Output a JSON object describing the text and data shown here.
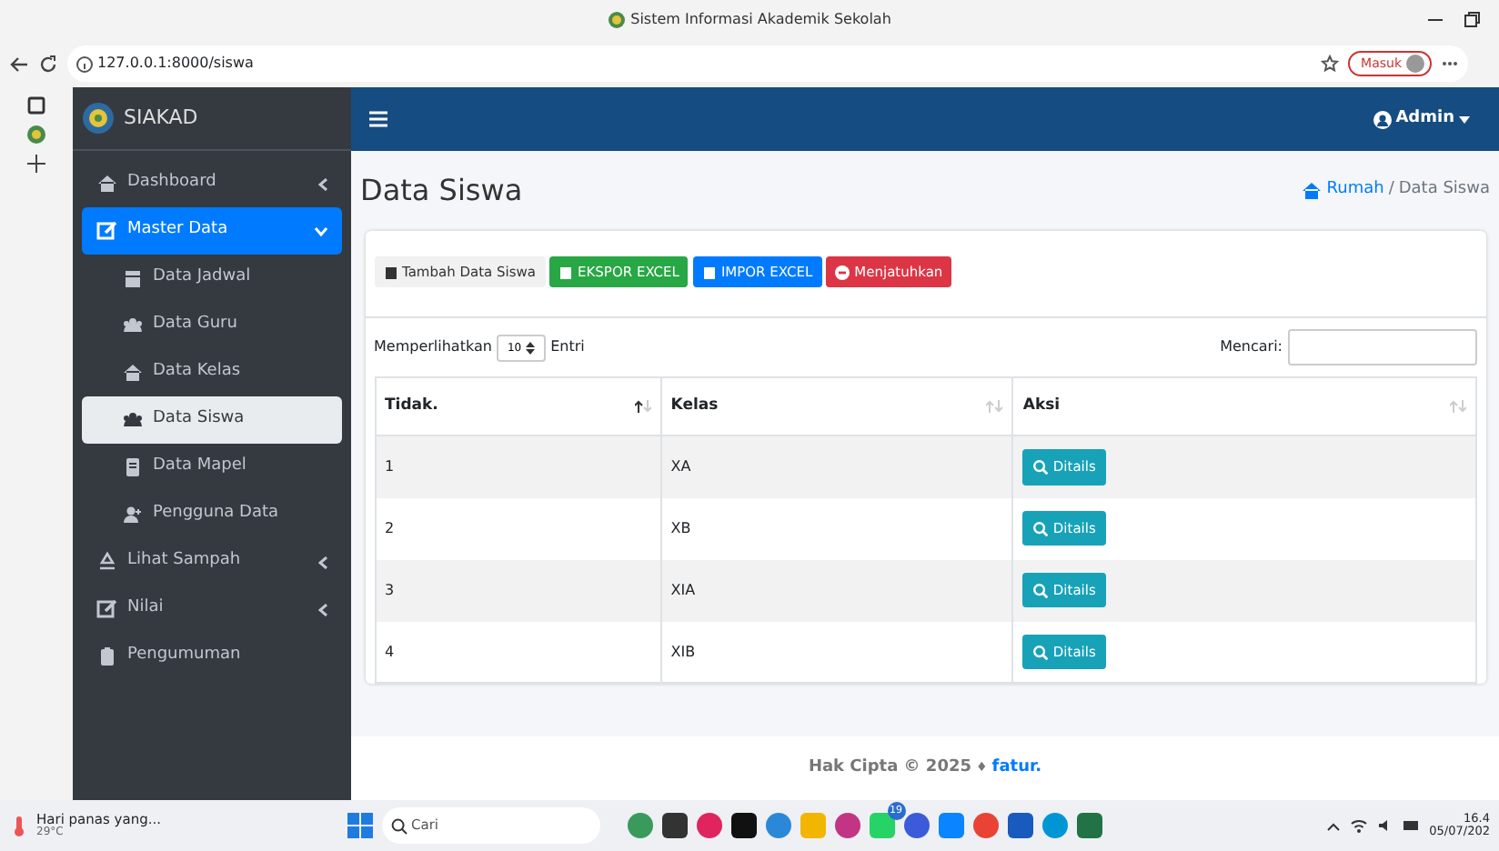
{
  "browser": {
    "title": "Sistem Informasi Akademik Sekolah",
    "url": "127.0.0.1:8000/siswa",
    "profile_button": "Masuk"
  },
  "app": {
    "brand": "SIAKAD",
    "user": "Admin"
  },
  "sidebar": {
    "items": [
      {
        "label": "Dashboard",
        "expanded": false,
        "selected": false
      },
      {
        "label": "Master Data",
        "expanded": true,
        "selected": true,
        "children": [
          {
            "label": "Data Jadwal",
            "selected": false
          },
          {
            "label": "Data Guru",
            "selected": false
          },
          {
            "label": "Data Kelas",
            "selected": false
          },
          {
            "label": "Data Siswa",
            "selected": true
          },
          {
            "label": "Data Mapel",
            "selected": false
          },
          {
            "label": "Pengguna Data",
            "selected": false
          }
        ]
      },
      {
        "label": "Lihat Sampah",
        "expanded": false,
        "selected": false
      },
      {
        "label": "Nilai",
        "expanded": false,
        "selected": false
      },
      {
        "label": "Pengumuman",
        "selected": false
      }
    ]
  },
  "page": {
    "title": "Data Siswa",
    "breadcrumb": {
      "home": "Rumah",
      "separator": "/",
      "current": "Data Siswa"
    }
  },
  "toolbar": [
    {
      "label": "Tambah Data Siswa",
      "kind": "light"
    },
    {
      "label": "EKSPOR EXCEL",
      "kind": "success"
    },
    {
      "label": "IMPOR EXCEL",
      "kind": "primary"
    },
    {
      "label": "Menjatuhkan",
      "kind": "danger"
    }
  ],
  "length": {
    "label": "Memperlihatkan",
    "value": "10",
    "suffix": "Entri"
  },
  "search": {
    "label": "Mencari:"
  },
  "table": {
    "columns": [
      {
        "label": "Tidak.",
        "sorted": true
      },
      {
        "label": "Kelas",
        "sorted": false
      },
      {
        "label": "Aksi",
        "sorted": false
      }
    ],
    "rows": [
      {
        "no": "1",
        "kelas": "XA",
        "action": "Ditails"
      },
      {
        "no": "2",
        "kelas": "XB",
        "action": "Ditails"
      },
      {
        "no": "3",
        "kelas": "XIA",
        "action": "Ditails"
      },
      {
        "no": "4",
        "kelas": "XIB",
        "action": "Ditails"
      }
    ]
  },
  "footer": {
    "text": "Hak Cipta © 2025",
    "separator": "♦",
    "author": "fatur."
  },
  "taskbar": {
    "weather": "Hari panas yang...",
    "temperature": "29°C",
    "search_placeholder": "Cari",
    "badge": "19",
    "time": "16.4",
    "date": "05/07/202"
  }
}
